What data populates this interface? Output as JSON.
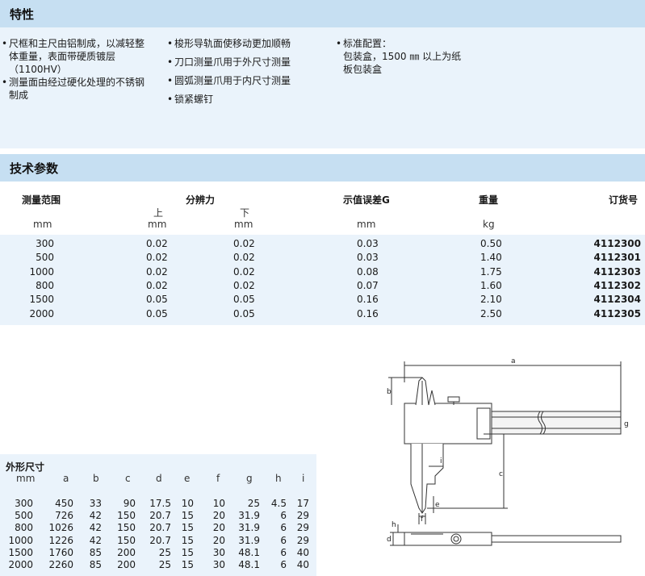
{
  "features": {
    "title": "特性",
    "col1": [
      "尺框和主尺由铝制成，以减轻整体重量，表面带硬质镀层（1100HV）",
      "测量面由经过硬化处理的不锈钢制成"
    ],
    "col2": [
      "梭形导轨面使移动更加顺畅",
      "刀口测量爪用于外尺寸测量",
      "圆弧测量爪用于内尺寸测量",
      "锁紧螺钉"
    ],
    "col3_title": "标准配置：",
    "col3_lines": [
      "包装盒，1500 ㎜ 以上为纸",
      "板包装盒"
    ]
  },
  "specs": {
    "title": "技术参数",
    "headers": {
      "range": "测量范围",
      "resolution": "分辨力",
      "upper": "上",
      "lower": "下",
      "error": "示值误差G",
      "weight": "重量",
      "order": "订货号"
    },
    "units": {
      "range": "mm",
      "upper": "mm",
      "lower": "mm",
      "error": "mm",
      "weight": "kg"
    },
    "rows": [
      {
        "range": "300",
        "upper": "0.02",
        "lower": "0.02",
        "error": "0.03",
        "weight": "0.50",
        "order": "4112300"
      },
      {
        "range": "500",
        "upper": "0.02",
        "lower": "0.02",
        "error": "0.03",
        "weight": "1.40",
        "order": "4112301"
      },
      {
        "range": "1000",
        "upper": "0.02",
        "lower": "0.02",
        "error": "0.08",
        "weight": "1.75",
        "order": "4112303"
      },
      {
        "range": "800",
        "upper": "0.02",
        "lower": "0.02",
        "error": "0.07",
        "weight": "1.60",
        "order": "4112302"
      },
      {
        "range": "1500",
        "upper": "0.05",
        "lower": "0.05",
        "error": "0.16",
        "weight": "2.10",
        "order": "4112304"
      },
      {
        "range": "2000",
        "upper": "0.05",
        "lower": "0.05",
        "error": "0.16",
        "weight": "2.50",
        "order": "4112305"
      }
    ]
  },
  "dimensions": {
    "title": "外形尺寸",
    "headers": [
      "mm",
      "a",
      "b",
      "c",
      "d",
      "e",
      "f",
      "g",
      "h",
      "i"
    ],
    "rows": [
      [
        "300",
        "450",
        "33",
        "90",
        "17.5",
        "10",
        "10",
        "25",
        "4.5",
        "17"
      ],
      [
        "500",
        "726",
        "42",
        "150",
        "20.7",
        "15",
        "20",
        "31.9",
        "6",
        "29"
      ],
      [
        "800",
        "1026",
        "42",
        "150",
        "20.7",
        "15",
        "20",
        "31.9",
        "6",
        "29"
      ],
      [
        "1000",
        "1226",
        "42",
        "150",
        "20.7",
        "15",
        "20",
        "31.9",
        "6",
        "29"
      ],
      [
        "1500",
        "1760",
        "85",
        "200",
        "25",
        "15",
        "30",
        "48.1",
        "6",
        "40"
      ],
      [
        "2000",
        "2260",
        "85",
        "200",
        "25",
        "15",
        "30",
        "48.1",
        "6",
        "40"
      ]
    ]
  },
  "drawing": {
    "labels": {
      "a": "a",
      "b": "b",
      "c": "c",
      "d": "d",
      "e": "e",
      "f": "f",
      "g": "g",
      "h": "h",
      "i": "i"
    }
  },
  "colors": {
    "band": "#c6dff2",
    "light": "#eaf3fb",
    "line": "#333333"
  }
}
